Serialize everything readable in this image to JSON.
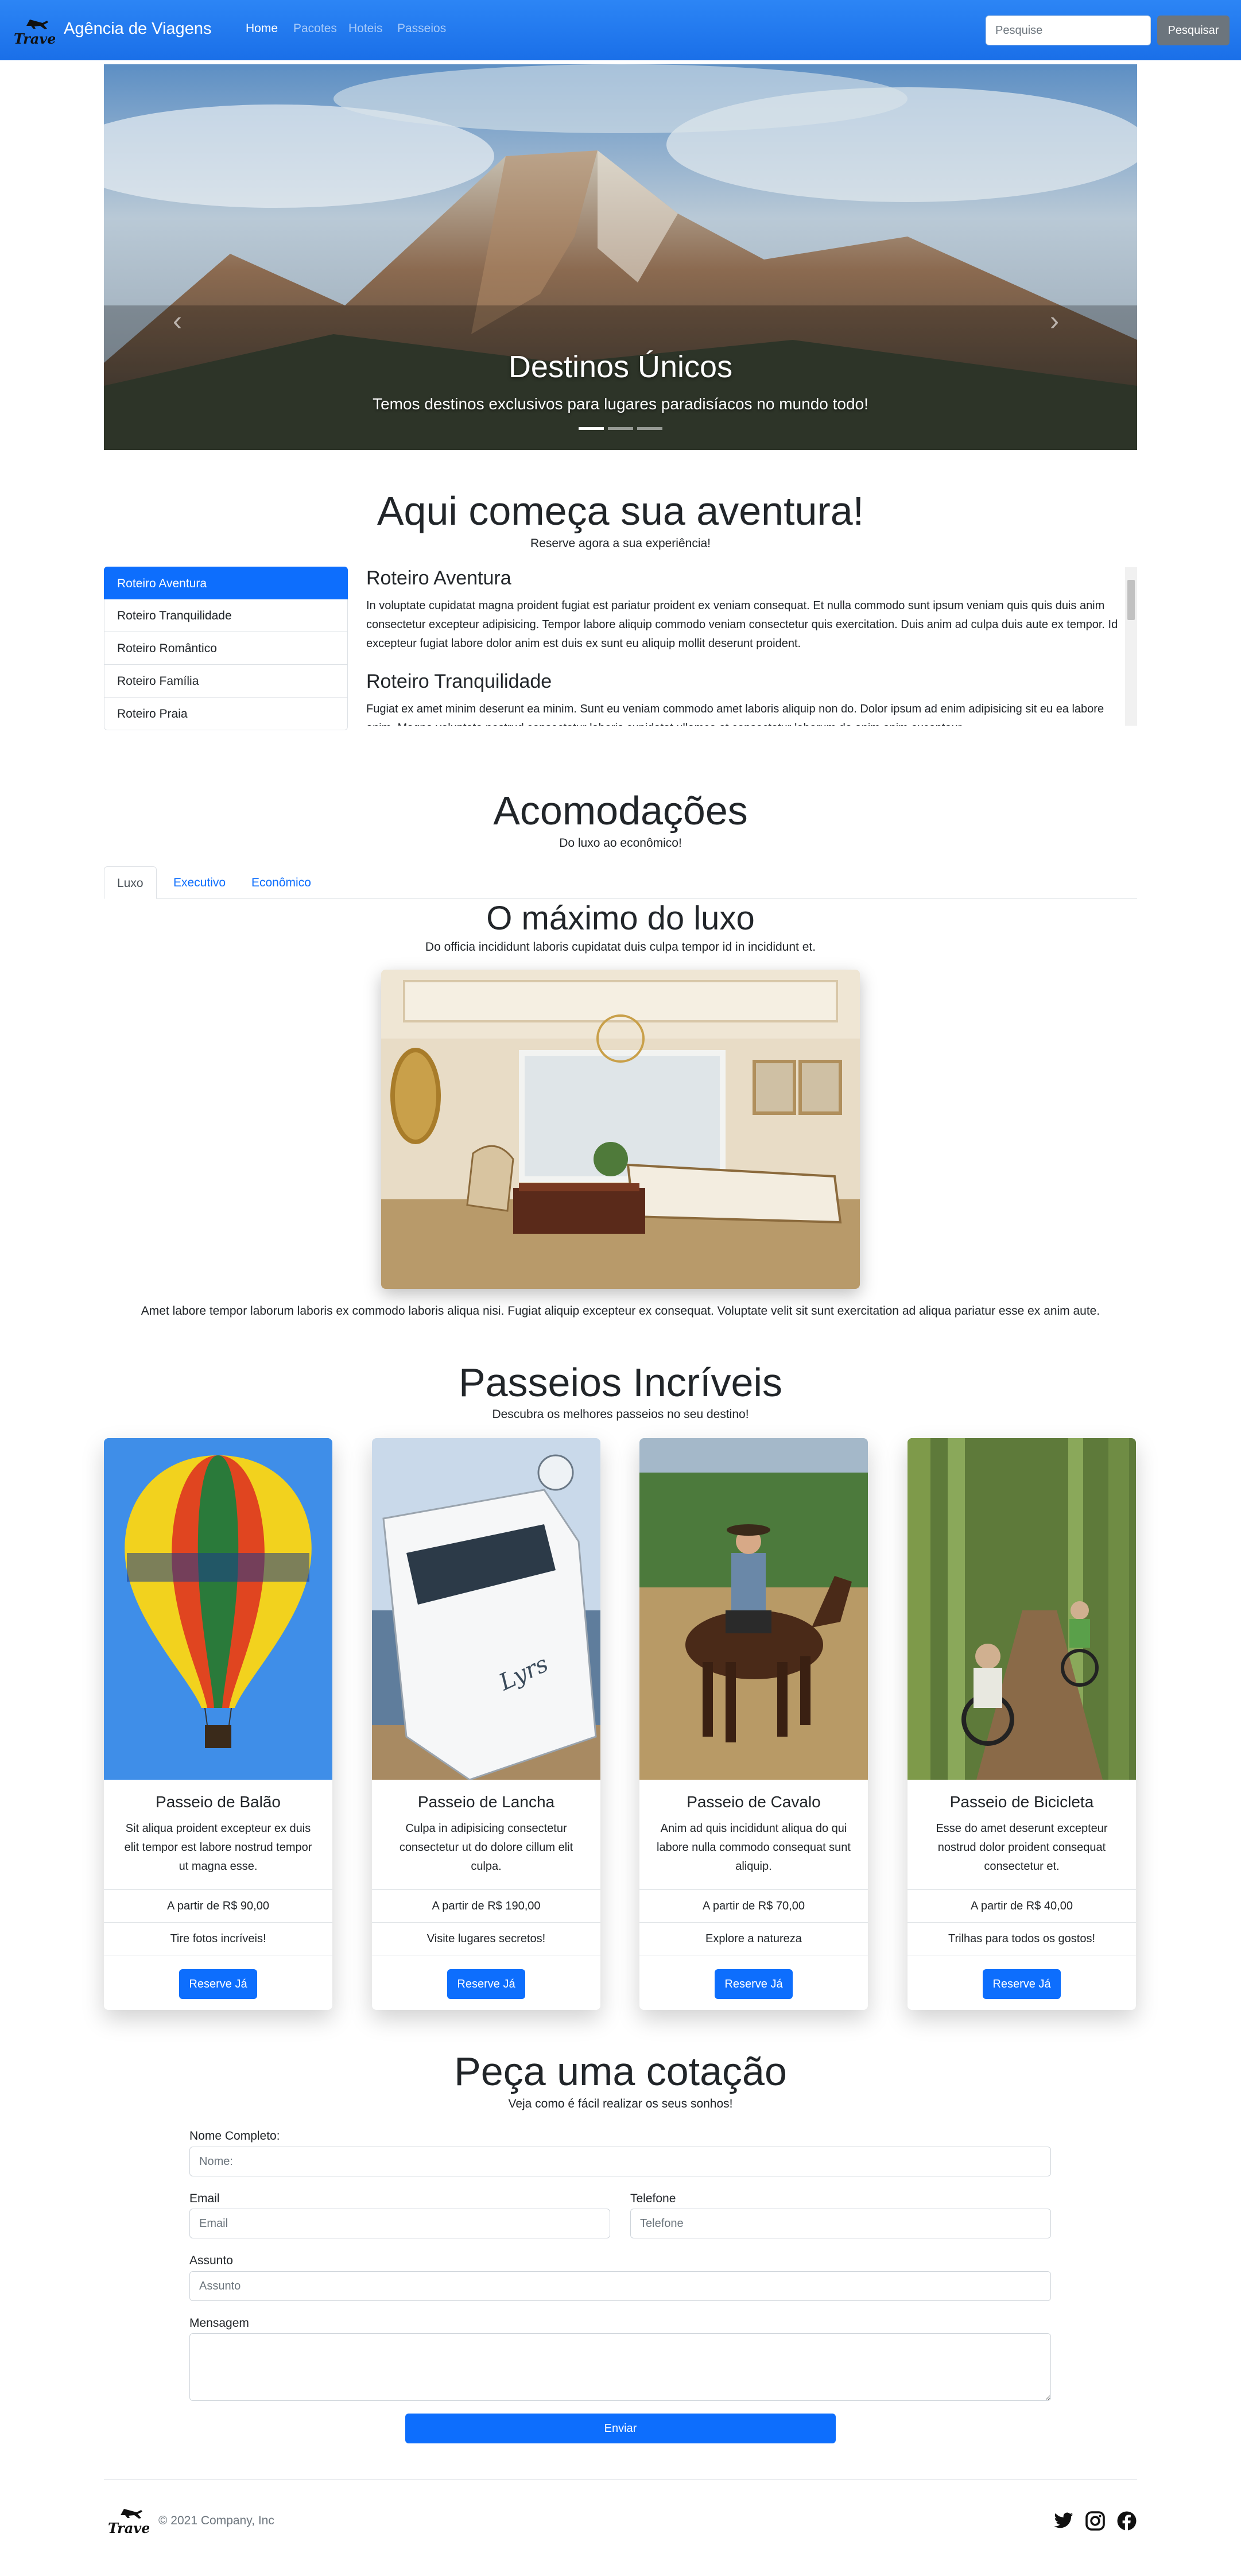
{
  "nav": {
    "logo_text": "Travel",
    "brand": "Agência de Viagens",
    "links": [
      {
        "label": "Home",
        "active": true
      },
      {
        "label": "Pacotes",
        "active": false
      },
      {
        "label": "Hoteis",
        "active": false
      },
      {
        "label": "Passeios",
        "active": false
      }
    ],
    "search_placeholder": "Pesquise",
    "search_button": "Pesquisar"
  },
  "carousel": {
    "title": "Destinos Únicos",
    "caption": "Temos destinos exclusivos para lugares paradisíacos no mundo todo!",
    "prev_icon": "chevron-left-icon",
    "next_icon": "chevron-right-icon",
    "indicators": 3,
    "active_indicator": 0
  },
  "adventure": {
    "title": "Aqui começa sua aventura!",
    "subtitle": "Reserve agora a sua experiência!",
    "items": [
      "Roteiro Aventura",
      "Roteiro Tranquilidade",
      "Roteiro Romântico",
      "Roteiro Família",
      "Roteiro Praia"
    ],
    "sections": [
      {
        "heading": "Roteiro Aventura",
        "text": "In voluptate cupidatat magna proident fugiat est pariatur proident ex veniam consequat. Et nulla commodo sunt ipsum veniam quis quis duis anim consectetur excepteur adipisicing. Tempor labore aliquip commodo veniam consectetur quis exercitation. Duis anim ad culpa duis aute ex tempor. Id excepteur fugiat labore dolor anim est duis ex sunt eu aliquip mollit deserunt proident."
      },
      {
        "heading": "Roteiro Tranquilidade",
        "text": "Fugiat ex amet minim deserunt ea minim. Sunt eu veniam commodo amet laboris aliquip non do. Dolor ipsum ad enim adipisicing sit eu ea labore anim. Magna voluptate nostrud consectetur laboris cupidatat ullamco et consectetur laborum do anim enim excepteur."
      }
    ]
  },
  "accommodations": {
    "title": "Acomodações",
    "subtitle": "Do luxo ao econômico!",
    "tabs": [
      "Luxo",
      "Executivo",
      "Econômico"
    ],
    "active_tab": 0,
    "panel_title": "O máximo do luxo",
    "panel_subtitle": "Do officia incididunt laboris cupidatat duis culpa tempor id in incididunt et.",
    "panel_text": "Amet labore tempor laborum laboris ex commodo laboris aliqua nisi. Fugiat aliquip excepteur ex consequat. Voluptate velit sit sunt exercitation ad aliqua pariatur esse ex anim aute."
  },
  "tours": {
    "title": "Passeios Incríveis",
    "subtitle": "Descubra os melhores passeios no seu destino!",
    "cards": [
      {
        "title": "Passeio de Balão",
        "text": "Sit aliqua proident excepteur ex duis elit tempor est labore nostrud tempor ut magna esse.",
        "price": "A partir de R$ 90,00",
        "tagline": "Tire fotos incríveis!",
        "button": "Reserve Já"
      },
      {
        "title": "Passeio de Lancha",
        "text": "Culpa in adipisicing consectetur consectetur ut do dolore cillum elit culpa.",
        "price": "A partir de R$ 190,00",
        "tagline": "Visite lugares secretos!",
        "button": "Reserve Já"
      },
      {
        "title": "Passeio de Cavalo",
        "text": "Anim ad quis incididunt aliqua do qui labore nulla commodo consequat sunt aliquip.",
        "price": "A partir de R$ 70,00",
        "tagline": "Explore a natureza",
        "button": "Reserve Já"
      },
      {
        "title": "Passeio de Bicicleta",
        "text": "Esse do amet deserunt excepteur nostrud dolor proident consequat consectetur et.",
        "price": "A partir de R$ 40,00",
        "tagline": "Trilhas para todos os gostos!",
        "button": "Reserve Já"
      }
    ]
  },
  "quote": {
    "title": "Peça uma cotação",
    "subtitle": "Veja como é fácil realizar os seus sonhos!",
    "name_label": "Nome Completo:",
    "name_placeholder": "Nome:",
    "email_label": "Email",
    "email_placeholder": "Email",
    "phone_label": "Telefone",
    "phone_placeholder": "Telefone",
    "subject_label": "Assunto",
    "subject_placeholder": "Assunto",
    "message_label": "Mensagem",
    "submit": "Enviar"
  },
  "footer": {
    "logo_text": "Travel",
    "copyright": "© 2021 Company, Inc",
    "social": [
      "twitter-icon",
      "instagram-icon",
      "facebook-icon"
    ]
  },
  "colors": {
    "primary": "#0d6efd",
    "navbar": "#1a6fe8",
    "secondary": "#6c757d"
  }
}
